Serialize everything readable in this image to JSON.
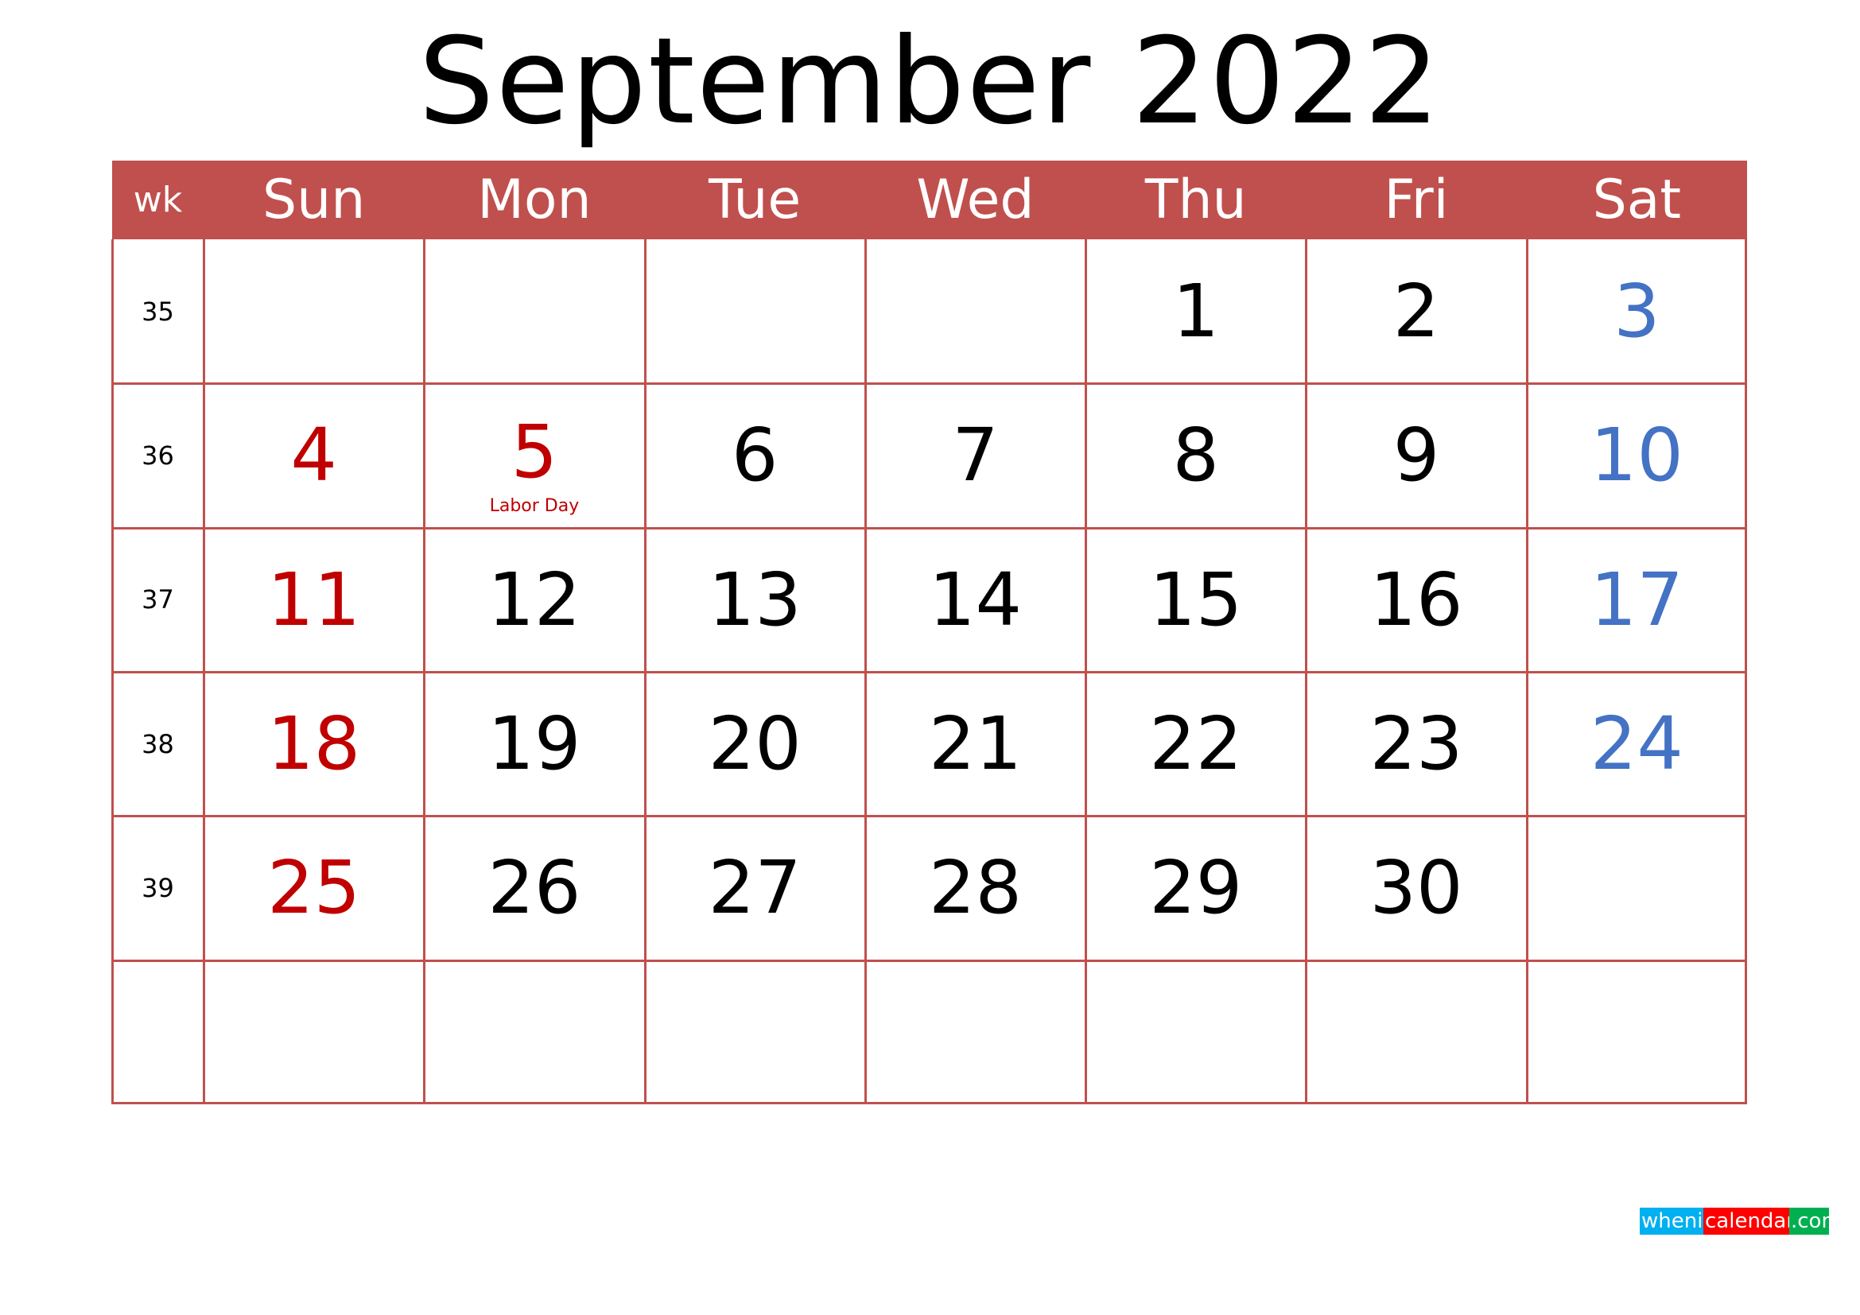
{
  "title": "September 2022",
  "colors": {
    "header_bg": "#c0504d",
    "grid_line": "#c0504d",
    "sunday": "#c00000",
    "saturday": "#4472c4",
    "holiday": "#c00000",
    "weekday": "#000000"
  },
  "header": {
    "week_label": "wk",
    "days": [
      "Sun",
      "Mon",
      "Tue",
      "Wed",
      "Thu",
      "Fri",
      "Sat"
    ]
  },
  "weeks": [
    {
      "wk": "35",
      "days": [
        "",
        "",
        "",
        "",
        "1",
        "2",
        "3"
      ]
    },
    {
      "wk": "36",
      "days": [
        "4",
        "5",
        "6",
        "7",
        "8",
        "9",
        "10"
      ]
    },
    {
      "wk": "37",
      "days": [
        "11",
        "12",
        "13",
        "14",
        "15",
        "16",
        "17"
      ]
    },
    {
      "wk": "38",
      "days": [
        "18",
        "19",
        "20",
        "21",
        "22",
        "23",
        "24"
      ]
    },
    {
      "wk": "39",
      "days": [
        "25",
        "26",
        "27",
        "28",
        "29",
        "30",
        ""
      ]
    },
    {
      "wk": "",
      "days": [
        "",
        "",
        "",
        "",
        "",
        "",
        ""
      ]
    }
  ],
  "holidays": [
    {
      "date": "5",
      "week_index": 1,
      "day_index": 1,
      "name": "Labor Day"
    }
  ],
  "watermark": {
    "parts": [
      "whenis",
      "calendars",
      ".com"
    ]
  }
}
